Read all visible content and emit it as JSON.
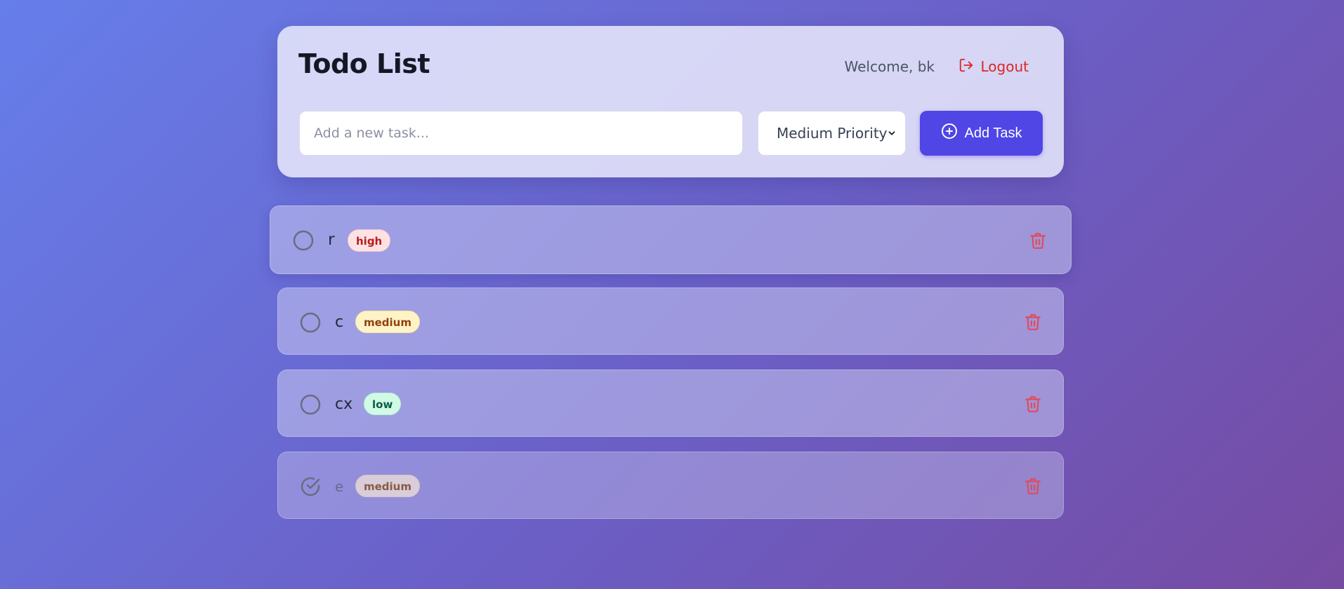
{
  "header": {
    "title": "Todo List",
    "welcome_text": "Welcome, bk",
    "logout_label": "Logout"
  },
  "form": {
    "input_placeholder": "Add a new task...",
    "input_value": "",
    "priority_selected": "Medium Priority",
    "add_button_label": "Add Task"
  },
  "todos": [
    {
      "text": "r",
      "priority": "high",
      "completed": false
    },
    {
      "text": "c",
      "priority": "medium",
      "completed": false
    },
    {
      "text": "cx",
      "priority": "low",
      "completed": false
    },
    {
      "text": "e",
      "priority": "medium",
      "completed": true
    }
  ],
  "colors": {
    "accent": "#4f46e5",
    "danger": "#dc2626",
    "high_badge": "#fde2e4",
    "medium_badge": "#fef3c7",
    "low_badge": "#d1fae5"
  },
  "icons": {
    "logout": "logout-icon",
    "add": "plus-circle-icon",
    "unchecked": "circle-icon",
    "checked": "check-circle-icon",
    "delete": "trash-icon"
  }
}
